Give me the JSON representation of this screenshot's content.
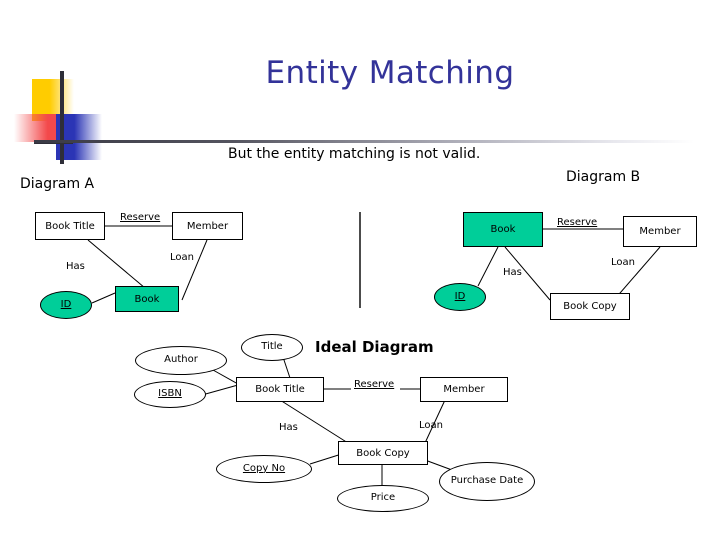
{
  "slide": {
    "title": "Entity Matching",
    "subtitle": "But the entity matching is not valid.",
    "title_color": "#333399",
    "entity_fill": "#00CE99",
    "logo": {
      "yellow": "#FFCC00",
      "red": "#F3494B",
      "blue": "#2B35B5",
      "cross": "#2E2E38"
    }
  },
  "diagram_a": {
    "label": "Diagram A",
    "entities": [
      {
        "name": "Book Title",
        "fill": "white"
      },
      {
        "name": "Member",
        "fill": "white"
      },
      {
        "name": "Book",
        "fill": "#00CE99"
      }
    ],
    "attributes": [
      {
        "name": "ID",
        "key": true,
        "fill": "#00CE99"
      }
    ],
    "relationships": [
      {
        "name": "Reserve",
        "underlined": true
      },
      {
        "name": "Has",
        "underlined": false
      },
      {
        "name": "Loan",
        "underlined": false
      }
    ]
  },
  "diagram_b": {
    "label": "Diagram B",
    "entities": [
      {
        "name": "Book",
        "fill": "#00CE99"
      },
      {
        "name": "Member",
        "fill": "white"
      },
      {
        "name": "Book Copy",
        "fill": "white"
      }
    ],
    "attributes": [
      {
        "name": "ID",
        "key": true,
        "fill": "#00CE99"
      }
    ],
    "relationships": [
      {
        "name": "Reserve",
        "underlined": true
      },
      {
        "name": "Has",
        "underlined": false
      },
      {
        "name": "Loan",
        "underlined": false
      }
    ]
  },
  "ideal_diagram": {
    "label": "Ideal Diagram",
    "entities": [
      {
        "name": "Book Title",
        "fill": "white"
      },
      {
        "name": "Member",
        "fill": "white"
      },
      {
        "name": "Book Copy",
        "fill": "white"
      }
    ],
    "attributes": [
      {
        "name": "Title",
        "key": false
      },
      {
        "name": "Author",
        "key": false
      },
      {
        "name": "ISBN",
        "key": true
      },
      {
        "name": "Copy No",
        "key": true
      },
      {
        "name": "Price",
        "key": false
      },
      {
        "name": "Purchase Date",
        "key": false
      }
    ],
    "relationships": [
      {
        "name": "Reserve",
        "underlined": true
      },
      {
        "name": "Has",
        "underlined": false
      },
      {
        "name": "Loan",
        "underlined": false
      }
    ]
  }
}
